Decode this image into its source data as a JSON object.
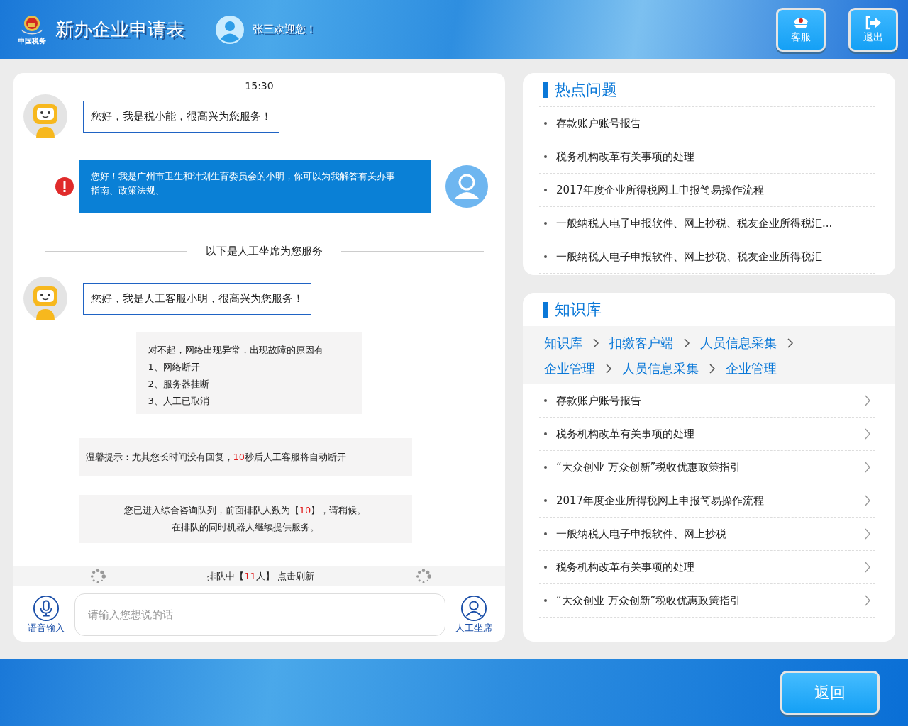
{
  "header": {
    "logo_caption": "中国税务",
    "title": "新办企业申请表",
    "greeting": "张三欢迎您！",
    "buttons": [
      {
        "label": "客服"
      },
      {
        "label": "退出"
      }
    ]
  },
  "chat": {
    "time": "15:30",
    "messages": [
      {
        "kind": "bot",
        "text": "您好，我是税小能，很高兴为您服务！"
      },
      {
        "kind": "user",
        "text": "您好！我是广州市卫生和计划生育委员会的小明，你可以为我解答有关办事指南、政策法规、",
        "error": true
      },
      {
        "kind": "divider",
        "text": "以下是人工坐席为您服务"
      },
      {
        "kind": "bot",
        "text": "您好，我是人工客服小明，很高兴为您服务！"
      },
      {
        "kind": "list",
        "lines": [
          "对不起，网络出现异常，出现故障的原因有",
          "1、网络断开",
          "2、服务器挂断",
          "3、人工已取消"
        ]
      },
      {
        "kind": "tip",
        "lines": [
          [
            {
              "text": "温馨提示：尤其您长时间没有回复，"
            },
            {
              "text": "10",
              "highlight": true
            },
            {
              "text": "秒后人工客服将自动断开"
            }
          ]
        ]
      },
      {
        "kind": "queue_notice",
        "lines": [
          [
            {
              "text": "您已进入综合咨询队列，前面排队人数为【"
            },
            {
              "text": "10",
              "highlight": true
            },
            {
              "text": "】，请稍候。"
            }
          ],
          [
            {
              "text": "在排队的同时机器人继续提供服务。"
            }
          ]
        ]
      }
    ],
    "queue": [
      {
        "text": "排队中【"
      },
      {
        "text": "11",
        "highlight": true
      },
      {
        "text": "人】 点击刷新"
      }
    ],
    "input": {
      "placeholder": "请输入您想说的话"
    },
    "voice_label": "语音输入",
    "agent_label": "人工坐席"
  },
  "hot": {
    "title": "热点问题",
    "items": [
      "存款账户账号报告",
      "税务机构改革有关事项的处理",
      "2017年度企业所得税网上申报简易操作流程",
      "一般纳税人电子申报软件、网上抄税、税友企业所得税汇...",
      "一般纳税人电子申报软件、网上抄税、税友企业所得税汇"
    ]
  },
  "kb": {
    "title": "知识库",
    "breadcrumb": [
      "知识库",
      "扣缴客户端",
      "人员信息采集",
      "企业管理",
      "人员信息采集",
      "企业管理"
    ],
    "items": [
      "存款账户账号报告",
      "税务机构改革有关事项的处理",
      "“大众创业 万众创新”税收优惠政策指引",
      "2017年度企业所得税网上申报简易操作流程",
      "一般纳税人电子申报软件、网上抄税",
      "税务机构改革有关事项的处理",
      "“大众创业 万众创新”税收优惠政策指引"
    ]
  },
  "back_button": "返回"
}
